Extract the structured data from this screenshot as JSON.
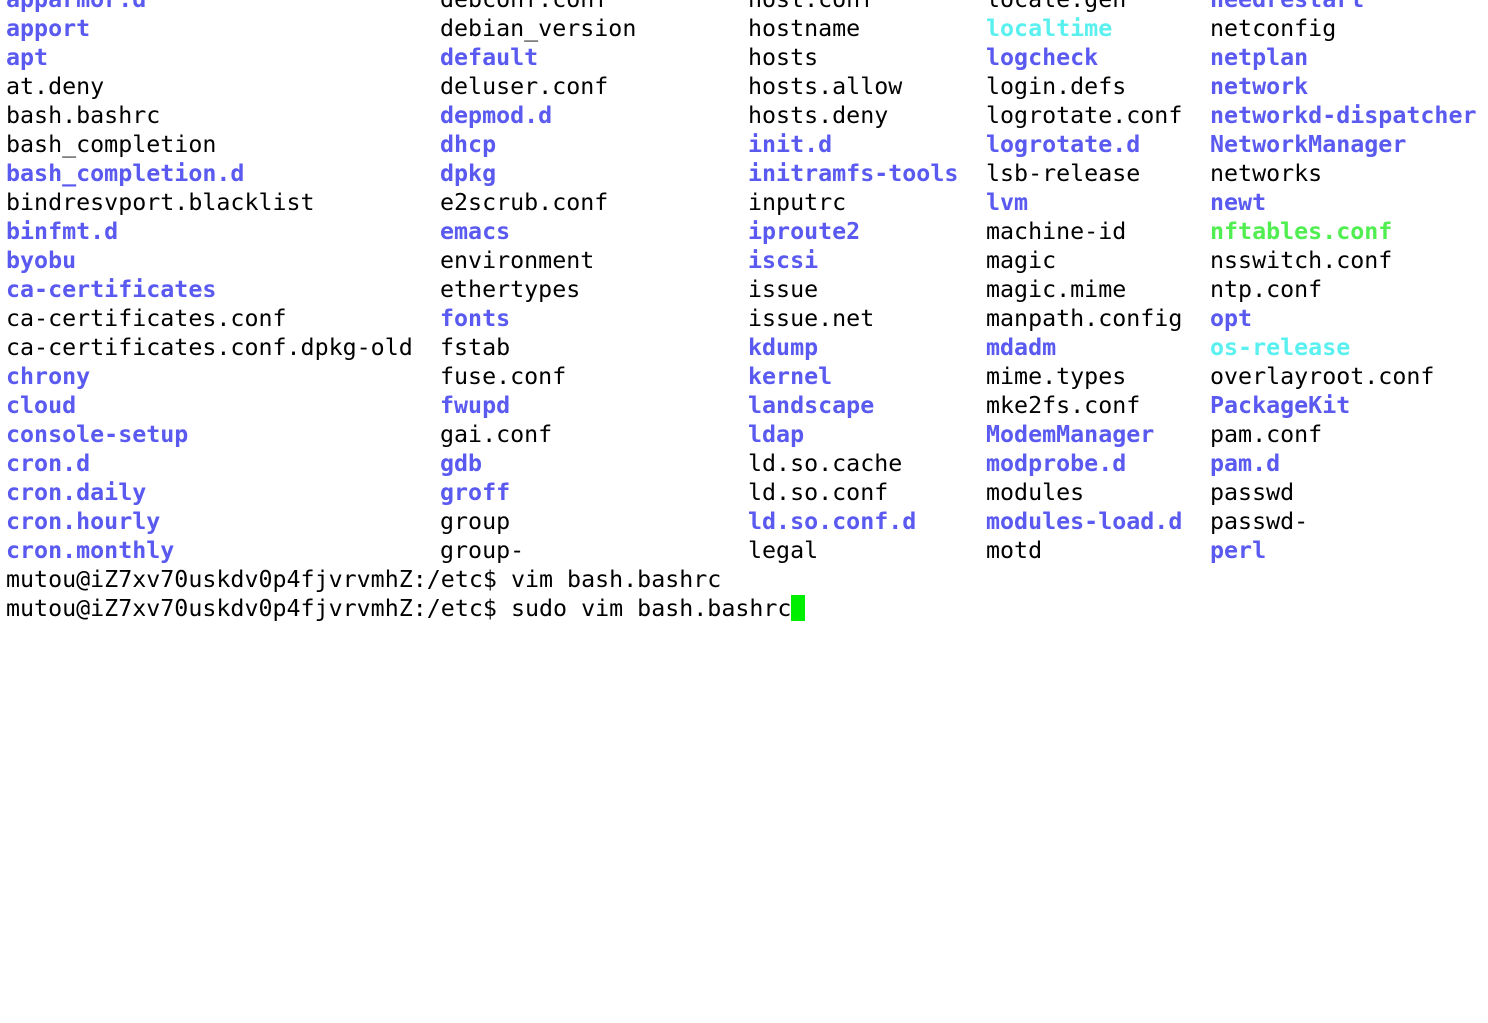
{
  "theme": {
    "background": "#ffffff",
    "text": "#000000",
    "directory": "#5a5af0",
    "symlink": "#5af0f0",
    "executable": "#50ee50",
    "cursor": "#00ee00"
  },
  "listing": {
    "columns": [
      {
        "entries": [
          {
            "name": "apparmor.d",
            "type": "dir"
          },
          {
            "name": "apport",
            "type": "dir"
          },
          {
            "name": "apt",
            "type": "dir"
          },
          {
            "name": "at.deny",
            "type": "file"
          },
          {
            "name": "bash.bashrc",
            "type": "file"
          },
          {
            "name": "bash_completion",
            "type": "file"
          },
          {
            "name": "bash_completion.d",
            "type": "dir"
          },
          {
            "name": "bindresvport.blacklist",
            "type": "file"
          },
          {
            "name": "binfmt.d",
            "type": "dir"
          },
          {
            "name": "byobu",
            "type": "dir"
          },
          {
            "name": "ca-certificates",
            "type": "dir"
          },
          {
            "name": "ca-certificates.conf",
            "type": "file"
          },
          {
            "name": "ca-certificates.conf.dpkg-old",
            "type": "file"
          },
          {
            "name": "chrony",
            "type": "dir"
          },
          {
            "name": "cloud",
            "type": "dir"
          },
          {
            "name": "console-setup",
            "type": "dir"
          },
          {
            "name": "cron.d",
            "type": "dir"
          },
          {
            "name": "cron.daily",
            "type": "dir"
          },
          {
            "name": "cron.hourly",
            "type": "dir"
          },
          {
            "name": "cron.monthly",
            "type": "dir"
          }
        ]
      },
      {
        "entries": [
          {
            "name": "debconf.conf",
            "type": "file"
          },
          {
            "name": "debian_version",
            "type": "file"
          },
          {
            "name": "default",
            "type": "dir"
          },
          {
            "name": "deluser.conf",
            "type": "file"
          },
          {
            "name": "depmod.d",
            "type": "dir"
          },
          {
            "name": "dhcp",
            "type": "dir"
          },
          {
            "name": "dpkg",
            "type": "dir"
          },
          {
            "name": "e2scrub.conf",
            "type": "file"
          },
          {
            "name": "emacs",
            "type": "dir"
          },
          {
            "name": "environment",
            "type": "file"
          },
          {
            "name": "ethertypes",
            "type": "file"
          },
          {
            "name": "fonts",
            "type": "dir"
          },
          {
            "name": "fstab",
            "type": "file"
          },
          {
            "name": "fuse.conf",
            "type": "file"
          },
          {
            "name": "fwupd",
            "type": "dir"
          },
          {
            "name": "gai.conf",
            "type": "file"
          },
          {
            "name": "gdb",
            "type": "dir"
          },
          {
            "name": "groff",
            "type": "dir"
          },
          {
            "name": "group",
            "type": "file"
          },
          {
            "name": "group-",
            "type": "file"
          }
        ]
      },
      {
        "entries": [
          {
            "name": "host.conf",
            "type": "file"
          },
          {
            "name": "hostname",
            "type": "file"
          },
          {
            "name": "hosts",
            "type": "file"
          },
          {
            "name": "hosts.allow",
            "type": "file"
          },
          {
            "name": "hosts.deny",
            "type": "file"
          },
          {
            "name": "init.d",
            "type": "dir"
          },
          {
            "name": "initramfs-tools",
            "type": "dir"
          },
          {
            "name": "inputrc",
            "type": "file"
          },
          {
            "name": "iproute2",
            "type": "dir"
          },
          {
            "name": "iscsi",
            "type": "dir"
          },
          {
            "name": "issue",
            "type": "file"
          },
          {
            "name": "issue.net",
            "type": "file"
          },
          {
            "name": "kdump",
            "type": "dir"
          },
          {
            "name": "kernel",
            "type": "dir"
          },
          {
            "name": "landscape",
            "type": "dir"
          },
          {
            "name": "ldap",
            "type": "dir"
          },
          {
            "name": "ld.so.cache",
            "type": "file"
          },
          {
            "name": "ld.so.conf",
            "type": "file"
          },
          {
            "name": "ld.so.conf.d",
            "type": "dir"
          },
          {
            "name": "legal",
            "type": "file"
          }
        ]
      },
      {
        "entries": [
          {
            "name": "locale.gen",
            "type": "file"
          },
          {
            "name": "localtime",
            "type": "link"
          },
          {
            "name": "logcheck",
            "type": "dir"
          },
          {
            "name": "login.defs",
            "type": "file"
          },
          {
            "name": "logrotate.conf",
            "type": "file"
          },
          {
            "name": "logrotate.d",
            "type": "dir"
          },
          {
            "name": "lsb-release",
            "type": "file"
          },
          {
            "name": "lvm",
            "type": "dir"
          },
          {
            "name": "machine-id",
            "type": "file"
          },
          {
            "name": "magic",
            "type": "file"
          },
          {
            "name": "magic.mime",
            "type": "file"
          },
          {
            "name": "manpath.config",
            "type": "file"
          },
          {
            "name": "mdadm",
            "type": "dir"
          },
          {
            "name": "mime.types",
            "type": "file"
          },
          {
            "name": "mke2fs.conf",
            "type": "file"
          },
          {
            "name": "ModemManager",
            "type": "dir"
          },
          {
            "name": "modprobe.d",
            "type": "dir"
          },
          {
            "name": "modules",
            "type": "file"
          },
          {
            "name": "modules-load.d",
            "type": "dir"
          },
          {
            "name": "motd",
            "type": "file"
          }
        ]
      },
      {
        "entries": [
          {
            "name": "needrestart",
            "type": "dir"
          },
          {
            "name": "netconfig",
            "type": "file"
          },
          {
            "name": "netplan",
            "type": "dir"
          },
          {
            "name": "network",
            "type": "dir"
          },
          {
            "name": "networkd-dispatcher",
            "type": "dir"
          },
          {
            "name": "NetworkManager",
            "type": "dir"
          },
          {
            "name": "networks",
            "type": "file"
          },
          {
            "name": "newt",
            "type": "dir"
          },
          {
            "name": "nftables.conf",
            "type": "exec"
          },
          {
            "name": "nsswitch.conf",
            "type": "file"
          },
          {
            "name": "ntp.conf",
            "type": "file"
          },
          {
            "name": "opt",
            "type": "dir"
          },
          {
            "name": "os-release",
            "type": "link"
          },
          {
            "name": "overlayroot.conf",
            "type": "file"
          },
          {
            "name": "PackageKit",
            "type": "dir"
          },
          {
            "name": "pam.conf",
            "type": "file"
          },
          {
            "name": "pam.d",
            "type": "dir"
          },
          {
            "name": "passwd",
            "type": "file"
          },
          {
            "name": "passwd-",
            "type": "file"
          },
          {
            "name": "perl",
            "type": "dir"
          }
        ]
      }
    ]
  },
  "shell": {
    "lines": [
      {
        "prompt": "mutou@iZ7xv70uskdv0p4fjvrvmhZ:/etc$ ",
        "command": "vim bash.bashrc"
      },
      {
        "prompt": "mutou@iZ7xv70uskdv0p4fjvrvmhZ:/etc$ ",
        "command": "sudo vim bash.bashrc"
      }
    ]
  }
}
